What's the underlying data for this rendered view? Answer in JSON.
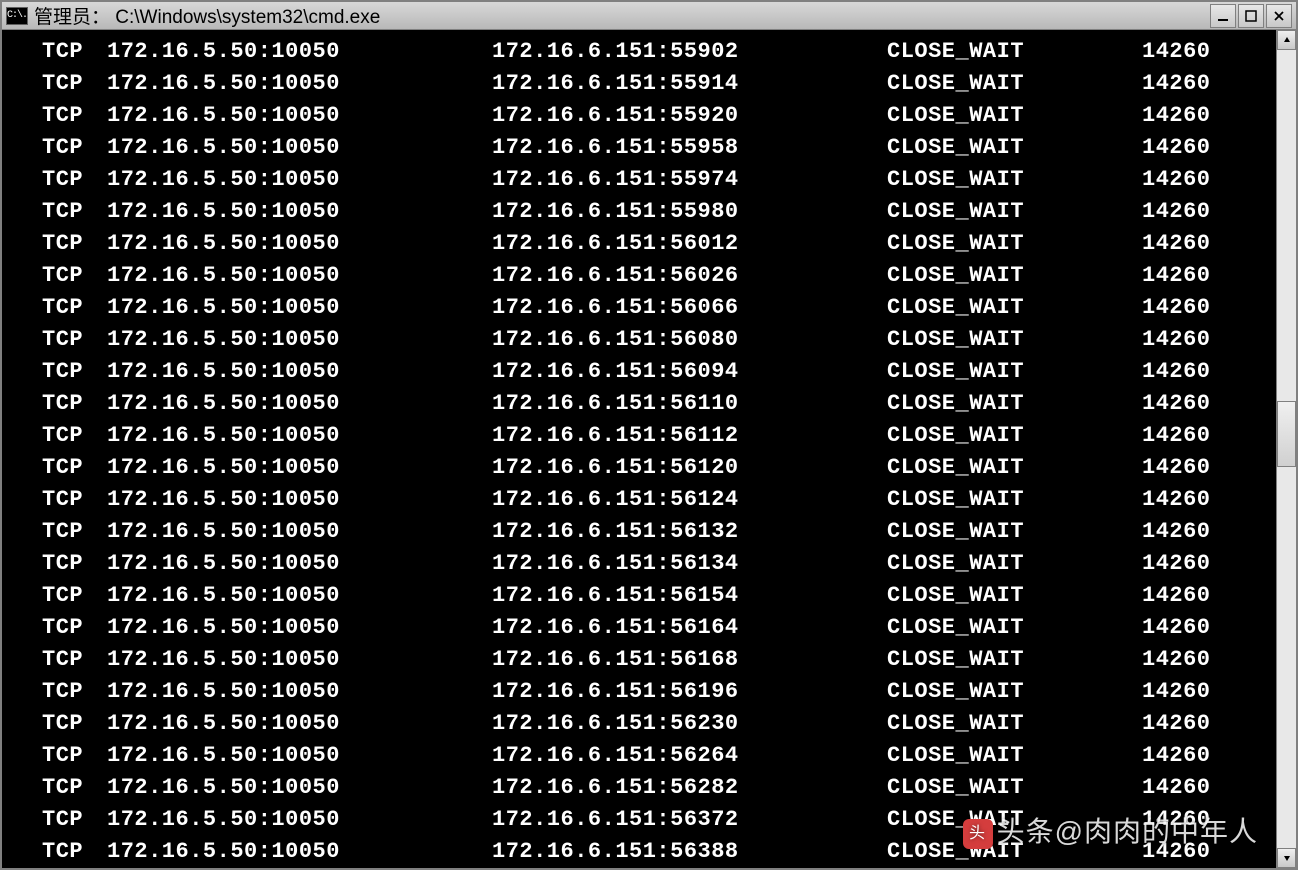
{
  "window": {
    "icon_text": "C:\\.",
    "title": "管理员： C:\\Windows\\system32\\cmd.exe"
  },
  "watermark": {
    "logo": "头",
    "text": "头条@肉肉的中年人"
  },
  "rows": [
    {
      "proto": "TCP",
      "local": "172.16.5.50:10050",
      "remote": "172.16.6.151:55902",
      "state": "CLOSE_WAIT",
      "pid": "14260"
    },
    {
      "proto": "TCP",
      "local": "172.16.5.50:10050",
      "remote": "172.16.6.151:55914",
      "state": "CLOSE_WAIT",
      "pid": "14260"
    },
    {
      "proto": "TCP",
      "local": "172.16.5.50:10050",
      "remote": "172.16.6.151:55920",
      "state": "CLOSE_WAIT",
      "pid": "14260"
    },
    {
      "proto": "TCP",
      "local": "172.16.5.50:10050",
      "remote": "172.16.6.151:55958",
      "state": "CLOSE_WAIT",
      "pid": "14260"
    },
    {
      "proto": "TCP",
      "local": "172.16.5.50:10050",
      "remote": "172.16.6.151:55974",
      "state": "CLOSE_WAIT",
      "pid": "14260"
    },
    {
      "proto": "TCP",
      "local": "172.16.5.50:10050",
      "remote": "172.16.6.151:55980",
      "state": "CLOSE_WAIT",
      "pid": "14260"
    },
    {
      "proto": "TCP",
      "local": "172.16.5.50:10050",
      "remote": "172.16.6.151:56012",
      "state": "CLOSE_WAIT",
      "pid": "14260"
    },
    {
      "proto": "TCP",
      "local": "172.16.5.50:10050",
      "remote": "172.16.6.151:56026",
      "state": "CLOSE_WAIT",
      "pid": "14260"
    },
    {
      "proto": "TCP",
      "local": "172.16.5.50:10050",
      "remote": "172.16.6.151:56066",
      "state": "CLOSE_WAIT",
      "pid": "14260"
    },
    {
      "proto": "TCP",
      "local": "172.16.5.50:10050",
      "remote": "172.16.6.151:56080",
      "state": "CLOSE_WAIT",
      "pid": "14260"
    },
    {
      "proto": "TCP",
      "local": "172.16.5.50:10050",
      "remote": "172.16.6.151:56094",
      "state": "CLOSE_WAIT",
      "pid": "14260"
    },
    {
      "proto": "TCP",
      "local": "172.16.5.50:10050",
      "remote": "172.16.6.151:56110",
      "state": "CLOSE_WAIT",
      "pid": "14260"
    },
    {
      "proto": "TCP",
      "local": "172.16.5.50:10050",
      "remote": "172.16.6.151:56112",
      "state": "CLOSE_WAIT",
      "pid": "14260"
    },
    {
      "proto": "TCP",
      "local": "172.16.5.50:10050",
      "remote": "172.16.6.151:56120",
      "state": "CLOSE_WAIT",
      "pid": "14260"
    },
    {
      "proto": "TCP",
      "local": "172.16.5.50:10050",
      "remote": "172.16.6.151:56124",
      "state": "CLOSE_WAIT",
      "pid": "14260"
    },
    {
      "proto": "TCP",
      "local": "172.16.5.50:10050",
      "remote": "172.16.6.151:56132",
      "state": "CLOSE_WAIT",
      "pid": "14260"
    },
    {
      "proto": "TCP",
      "local": "172.16.5.50:10050",
      "remote": "172.16.6.151:56134",
      "state": "CLOSE_WAIT",
      "pid": "14260"
    },
    {
      "proto": "TCP",
      "local": "172.16.5.50:10050",
      "remote": "172.16.6.151:56154",
      "state": "CLOSE_WAIT",
      "pid": "14260"
    },
    {
      "proto": "TCP",
      "local": "172.16.5.50:10050",
      "remote": "172.16.6.151:56164",
      "state": "CLOSE_WAIT",
      "pid": "14260"
    },
    {
      "proto": "TCP",
      "local": "172.16.5.50:10050",
      "remote": "172.16.6.151:56168",
      "state": "CLOSE_WAIT",
      "pid": "14260"
    },
    {
      "proto": "TCP",
      "local": "172.16.5.50:10050",
      "remote": "172.16.6.151:56196",
      "state": "CLOSE_WAIT",
      "pid": "14260"
    },
    {
      "proto": "TCP",
      "local": "172.16.5.50:10050",
      "remote": "172.16.6.151:56230",
      "state": "CLOSE_WAIT",
      "pid": "14260"
    },
    {
      "proto": "TCP",
      "local": "172.16.5.50:10050",
      "remote": "172.16.6.151:56264",
      "state": "CLOSE_WAIT",
      "pid": "14260"
    },
    {
      "proto": "TCP",
      "local": "172.16.5.50:10050",
      "remote": "172.16.6.151:56282",
      "state": "CLOSE_WAIT",
      "pid": "14260"
    },
    {
      "proto": "TCP",
      "local": "172.16.5.50:10050",
      "remote": "172.16.6.151:56372",
      "state": "CLOSE_WAIT",
      "pid": "14260"
    },
    {
      "proto": "TCP",
      "local": "172.16.5.50:10050",
      "remote": "172.16.6.151:56388",
      "state": "CLOSE_WAIT",
      "pid": "14260"
    }
  ]
}
